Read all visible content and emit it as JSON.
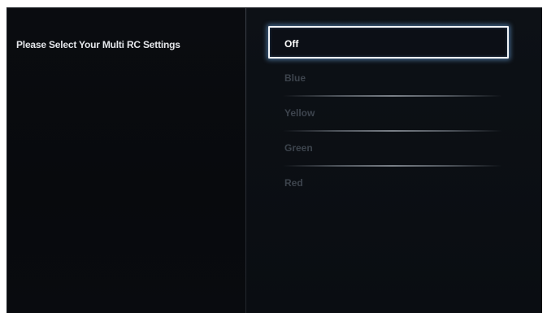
{
  "settings": {
    "prompt": "Please Select Your Multi RC Settings",
    "options": [
      {
        "label": "Off",
        "selected": true
      },
      {
        "label": "Blue",
        "selected": false
      },
      {
        "label": "Yellow",
        "selected": false
      },
      {
        "label": "Green",
        "selected": false
      },
      {
        "label": "Red",
        "selected": false
      }
    ]
  },
  "colors": {
    "background": "#0a0c10",
    "text_active": "#ffffff",
    "text_inactive": "#3d444d",
    "focus_glow": "#6eaae6"
  }
}
